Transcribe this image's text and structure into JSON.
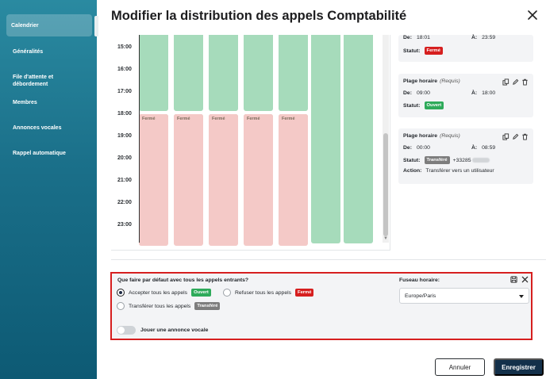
{
  "sidebar": {
    "items": [
      {
        "label": "Calendrier"
      },
      {
        "label": "Généralités"
      },
      {
        "label": "File d'attente et débordement"
      },
      {
        "label": "Membres"
      },
      {
        "label": "Annonces vocales"
      },
      {
        "label": "Rappel automatique"
      }
    ]
  },
  "dialog": {
    "title": "Modifier la distribution des appels Comptabilité"
  },
  "calendar": {
    "hours": [
      "15:00",
      "16:00",
      "17:00",
      "18:00",
      "19:00",
      "20:00",
      "21:00",
      "22:00",
      "23:00"
    ],
    "closed_label": "Fermé"
  },
  "schedule_cards": [
    {
      "de_label": "De:",
      "de_value": "18:01",
      "a_label": "À:",
      "a_value": "23:59",
      "statut_label": "Statut:",
      "statut_badge": "Fermé"
    },
    {
      "title": "Plage horaire",
      "required": "(Requis)",
      "de_label": "De:",
      "de_value": "09:00",
      "a_label": "À:",
      "a_value": "18:00",
      "statut_label": "Statut:",
      "statut_badge": "Ouvert"
    },
    {
      "title": "Plage horaire",
      "required": "(Requis)",
      "de_label": "De:",
      "de_value": "00:00",
      "a_label": "À:",
      "a_value": "08:59",
      "statut_label": "Statut:",
      "statut_badge": "Transféré",
      "phone": "+33285",
      "action_label": "Action:",
      "action_value": "Transférer vers un utilisateur"
    }
  ],
  "default_behavior": {
    "question": "Que faire par défaut avec tous les appels entrants?",
    "options": [
      {
        "label": "Accepter tous les appels",
        "badge": "Ouvert",
        "selected": true
      },
      {
        "label": "Refuser tous les appels",
        "badge": "Fermé",
        "selected": false
      },
      {
        "label": "Transférer tous les appels",
        "badge": "Transféré",
        "selected": false
      }
    ],
    "toggle_label": "Jouer une annonce vocale",
    "toggle_on": false,
    "timezone_label": "Fuseau horaire:",
    "timezone_value": "Europe/Paris"
  },
  "footer": {
    "cancel_label": "Annuler",
    "save_label": "Enregistrer"
  },
  "colors": {
    "open_green": "#a6dbbb",
    "closed_red": "#f4c9c7",
    "badge_green": "#2eaa5a",
    "badge_red": "#d61f1f",
    "badge_gray": "#7d7d7d",
    "save_button": "#13304a",
    "highlight_border": "#d61f1f"
  }
}
